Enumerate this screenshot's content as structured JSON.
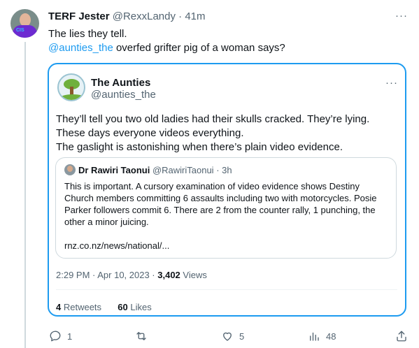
{
  "tweet": {
    "author_name": "TERF Jester",
    "handle": "@RexxLandy",
    "separator": "·",
    "time": "41m",
    "more": "···",
    "line1": "The lies they tell.",
    "mention": "@aunties_the",
    "line2_rest": " overfed grifter pig of a woman says?"
  },
  "quote": {
    "author_name": "The Aunties",
    "handle": "@aunties_the",
    "more": "···",
    "text_lines": [
      "They’ll tell you two old ladies had their skulls cracked. They’re lying.",
      "These days everyone videos everything.",
      "The gaslight is astonishing when there’s plain video evidence."
    ],
    "nested": {
      "author_name": "Dr Rawiri Taonui",
      "handle": "@RawiriTaonui",
      "separator": "·",
      "time": "3h",
      "body_lines": [
        "This is important. A cursory examination of video evidence shows Destiny",
        "Church members committing 6 assaults including two with motorcycles. Posie",
        "Parker followers commit 6. There are 2 from the counter rally, 1 punching, the",
        "other a minor juicing."
      ],
      "link": "rnz.co.nz/news/national/..."
    },
    "meta_time": "2:29 PM · Apr 10, 2023 · ",
    "views_count": "3,402",
    "views_label": " Views",
    "retweets_count": "4",
    "retweets_label": " Retweets",
    "likes_count": "60",
    "likes_label": " Likes"
  },
  "actions": {
    "reply_count": "1",
    "retweet_count": "",
    "like_count": "5",
    "views_count": "48"
  },
  "colors": {
    "accent": "#1d9bf0",
    "muted": "#536471",
    "text": "#0f1419",
    "border": "#cfd9de"
  }
}
